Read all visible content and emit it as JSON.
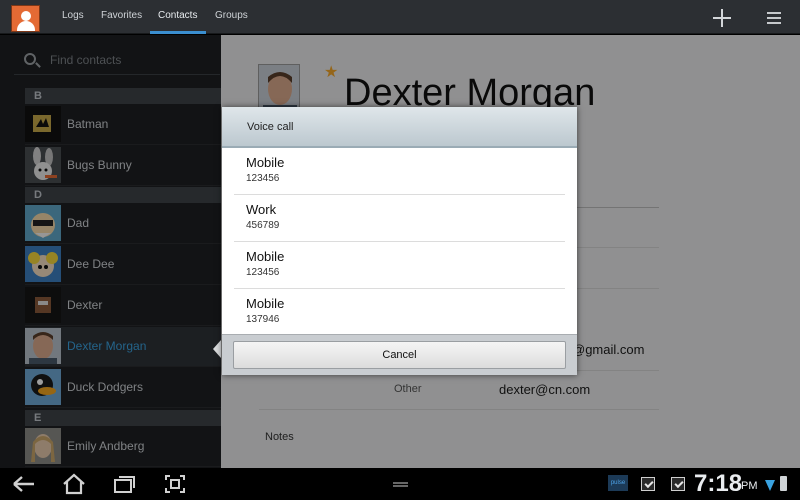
{
  "topbar": {
    "tabs": [
      {
        "label": "Logs"
      },
      {
        "label": "Favorites"
      },
      {
        "label": "Contacts"
      },
      {
        "label": "Groups"
      }
    ],
    "active_tab": "Contacts"
  },
  "search": {
    "placeholder": "Find contacts"
  },
  "contacts": {
    "sections": [
      {
        "letter": "B"
      },
      {
        "letter": "D"
      },
      {
        "letter": "E"
      }
    ],
    "items": [
      {
        "name": "Batman"
      },
      {
        "name": "Bugs Bunny"
      },
      {
        "name": "Dad"
      },
      {
        "name": "Dee Dee"
      },
      {
        "name": "Dexter"
      },
      {
        "name": "Dexter Morgan"
      },
      {
        "name": "Duck Dodgers"
      },
      {
        "name": "Emily Andberg"
      }
    ],
    "selected": "Dexter Morgan"
  },
  "detail": {
    "name": "Dexter Morgan",
    "email_partial": "@gmail.com",
    "email_other_label": "Other",
    "email_other": "dexter@cn.com",
    "notes_label": "Notes"
  },
  "dialog": {
    "title": "Voice call",
    "options": [
      {
        "type": "Mobile",
        "number": "123456"
      },
      {
        "type": "Work",
        "number": "456789"
      },
      {
        "type": "Mobile",
        "number": "123456"
      },
      {
        "type": "Mobile",
        "number": "137946"
      }
    ],
    "cancel_label": "Cancel"
  },
  "statusbar": {
    "pulse_label": "pulse",
    "time": "7:18",
    "ampm": "PM"
  },
  "colors": {
    "accent": "#3aa2e0",
    "star": "#f1a52a",
    "app_icon": "#e46a34"
  },
  "icons": [
    "contacts-app-icon",
    "add-icon",
    "menu-icon",
    "search-icon",
    "star-icon",
    "back-icon",
    "home-icon",
    "recent-apps-icon",
    "screenshot-icon",
    "wifi-icon",
    "battery-icon"
  ]
}
